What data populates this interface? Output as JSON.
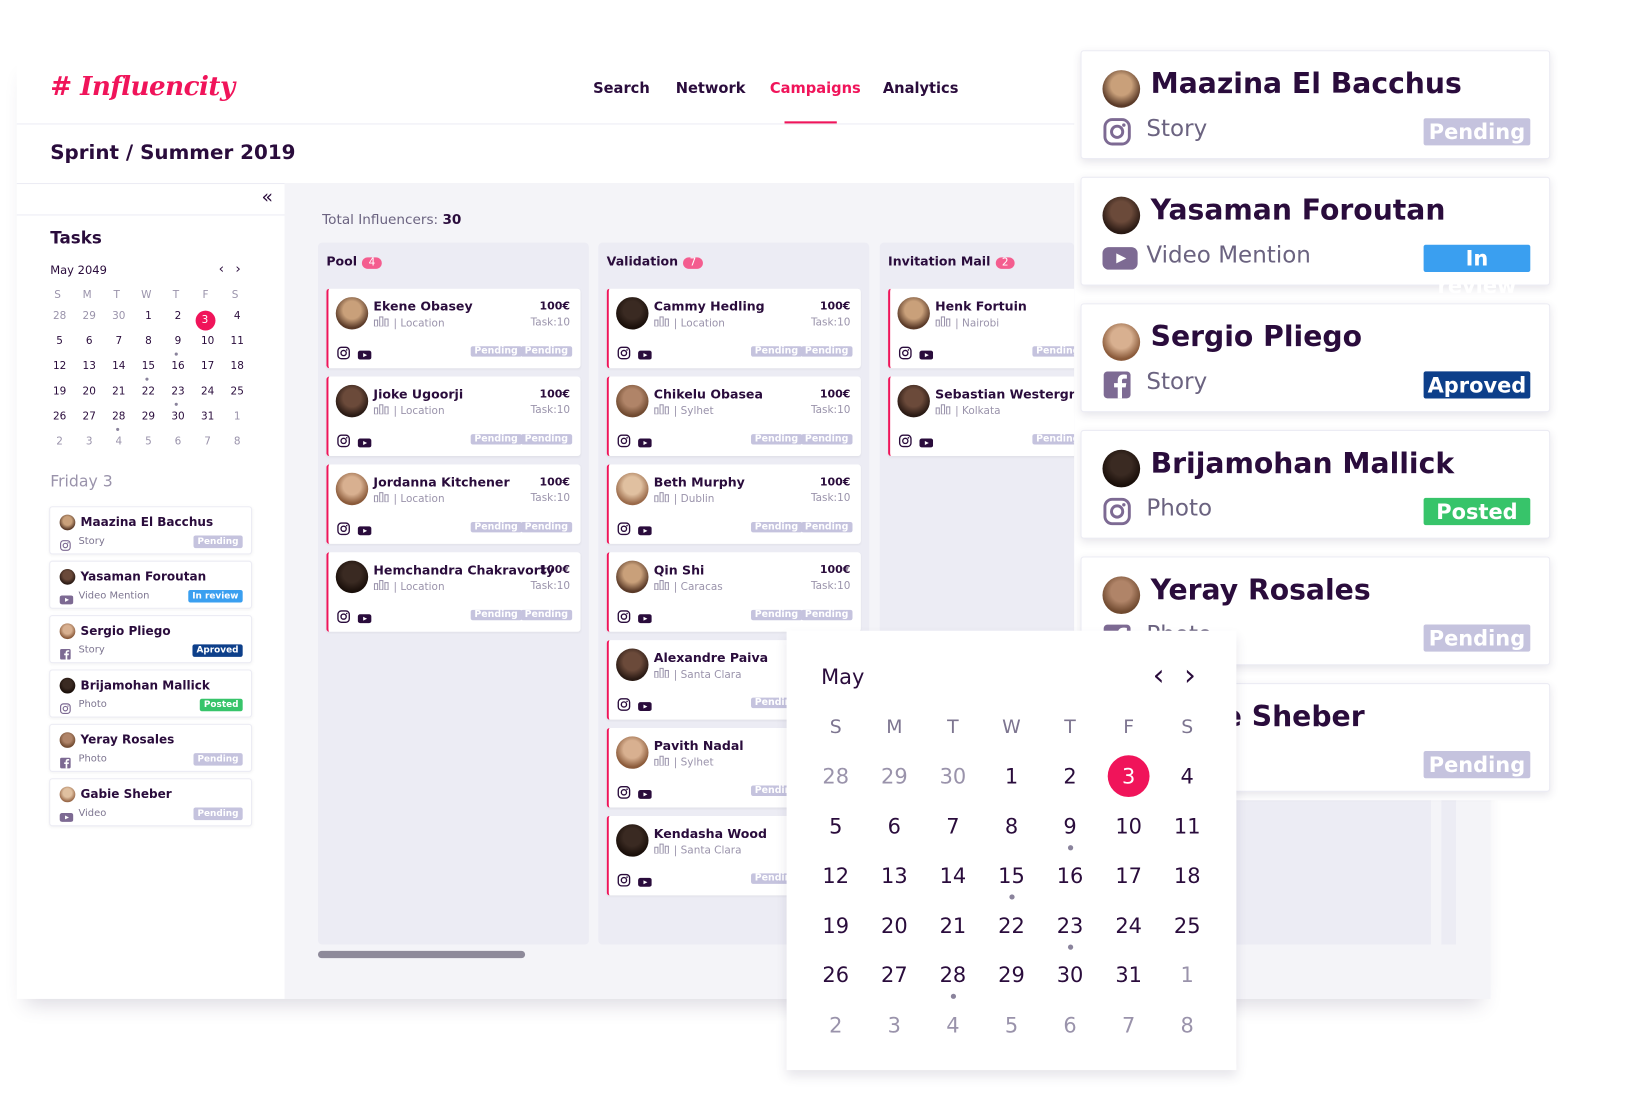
{
  "colors": {
    "accent": "#f0145a",
    "text": "#2a0c3c",
    "pending": "#c5c3de",
    "in_review": "#3a9ff0",
    "approved": "#0d3f8a",
    "posted": "#37c46a"
  },
  "header": {
    "logo": "# Influencity",
    "nav": [
      "Search",
      "Network",
      "Campaigns",
      "Analytics"
    ],
    "active_nav": "Campaigns"
  },
  "page_title": "Sprint / Summer 2019",
  "sidebar": {
    "title": "Tasks",
    "calendar": {
      "month": "May 2049",
      "weekdays": [
        "S",
        "M",
        "T",
        "W",
        "T",
        "F",
        "S"
      ],
      "weeks": [
        [
          "28",
          "29",
          "30",
          "1",
          "2",
          "3",
          "4"
        ],
        [
          "5",
          "6",
          "7",
          "8",
          "9",
          "10",
          "11"
        ],
        [
          "12",
          "13",
          "14",
          "15",
          "16",
          "17",
          "18"
        ],
        [
          "19",
          "20",
          "21",
          "22",
          "23",
          "24",
          "25"
        ],
        [
          "26",
          "27",
          "28",
          "29",
          "30",
          "31",
          "1"
        ],
        [
          "2",
          "3",
          "4",
          "5",
          "6",
          "7",
          "8"
        ]
      ],
      "selected": "3",
      "marked": [
        "9",
        "15",
        "23",
        "28"
      ]
    },
    "day_label": "Friday 3"
  },
  "tasks": [
    {
      "name": "Maazina El Bacchus",
      "type": "Story",
      "platform": "instagram-icon",
      "status": "Pending",
      "status_key": "pending"
    },
    {
      "name": "Yasaman Foroutan",
      "type": "Video Mention",
      "platform": "youtube-icon",
      "status": "In review",
      "status_key": "in_review"
    },
    {
      "name": "Sergio Pliego",
      "type": "Story",
      "platform": "facebook-icon",
      "status": "Aproved",
      "status_key": "approved"
    },
    {
      "name": "Brijamohan Mallick",
      "type": "Photo",
      "platform": "instagram-icon",
      "status": "Posted",
      "status_key": "posted"
    },
    {
      "name": "Yeray Rosales",
      "type": "Photo",
      "platform": "facebook-icon",
      "status": "Pending",
      "status_key": "pending"
    },
    {
      "name": "Gabie Sheber",
      "type": "Video",
      "platform": "youtube-icon",
      "status": "Pending",
      "status_key": "pending"
    }
  ],
  "board": {
    "total_label": "Total Influencers:",
    "total": "30",
    "columns": [
      {
        "title": "Pool",
        "count": "4",
        "cards": [
          {
            "name": "Ekene Obasey",
            "location": "Location"
          },
          {
            "name": "Jioke Ugoorji",
            "location": "Location"
          },
          {
            "name": "Jordanna Kitchener",
            "location": "Location"
          },
          {
            "name": "Hemchandra Chakravorty",
            "location": "Location"
          }
        ]
      },
      {
        "title": "Validation",
        "count": "7",
        "cards": [
          {
            "name": "Cammy Hedling",
            "location": "Location"
          },
          {
            "name": "Chikelu Obasea",
            "location": "Sylhet"
          },
          {
            "name": "Beth Murphy",
            "location": "Dublin"
          },
          {
            "name": "Qin Shi",
            "location": "Caracas"
          },
          {
            "name": "Alexandre Paiva",
            "location": "Santa Clara"
          },
          {
            "name": "Pavith Nadal",
            "location": "Sylhet"
          },
          {
            "name": "Kendasha Wood",
            "location": "Santa Clara"
          }
        ]
      },
      {
        "title": "Invitation Mail",
        "count": "2",
        "cards": [
          {
            "name": "Henk Fortuin",
            "location": "Nairobi"
          },
          {
            "name": "Sebastian Westergren",
            "location": "Kolkata"
          }
        ]
      }
    ],
    "card_price": "100€",
    "card_task": "Task:10",
    "card_badges": [
      "Pending",
      "Pending"
    ]
  },
  "big_calendar": {
    "month": "May"
  }
}
